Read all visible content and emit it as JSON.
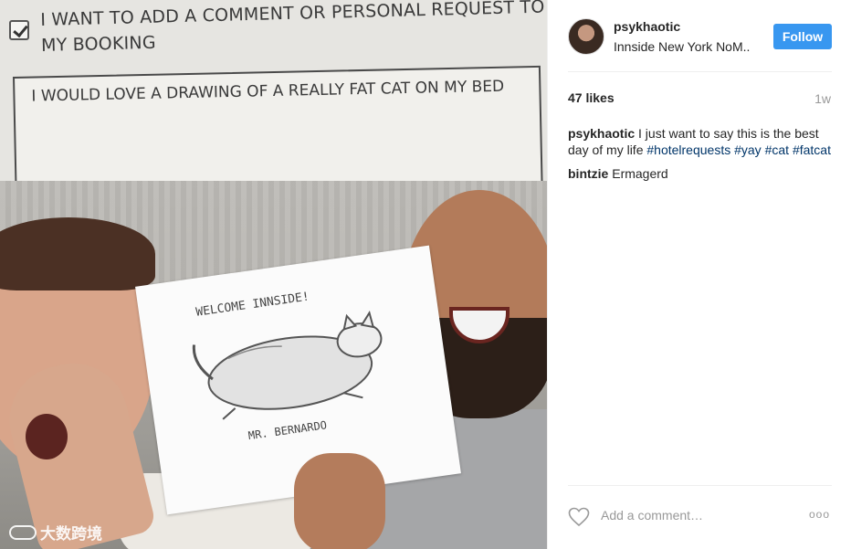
{
  "photo": {
    "request_label": "I WANT TO ADD A COMMENT OR PERSONAL REQUEST TO MY BOOKING",
    "request_checked": true,
    "request_text": "I WOULD LOVE A DRAWING OF A REALLY FAT CAT ON MY BED",
    "drawing_header": "WELCOME INNSIDE!",
    "drawing_signature": "MR. BERNARDO",
    "watermark": "大数跨境"
  },
  "post": {
    "username": "psykhaotic",
    "location": "Innside New York NoM..",
    "follow_label": "Follow",
    "likes": "47 likes",
    "age": "1w",
    "comments": [
      {
        "user": "psykhaotic",
        "text": "I just want to say this is the best day of my life",
        "hashtags": [
          "#hotelrequests",
          "#yay",
          "#cat",
          "#fatcat"
        ]
      },
      {
        "user": "bintzie",
        "text": "Ermagerd",
        "hashtags": []
      }
    ],
    "add_comment_placeholder": "Add a comment…",
    "more_label": "ooo"
  },
  "icons": {
    "heart": "heart-icon",
    "more": "more-options-icon",
    "checkbox": "checkbox-checked-icon"
  },
  "colors": {
    "follow_button": "#3897f0",
    "hashtag": "#003569",
    "muted": "#999999"
  }
}
